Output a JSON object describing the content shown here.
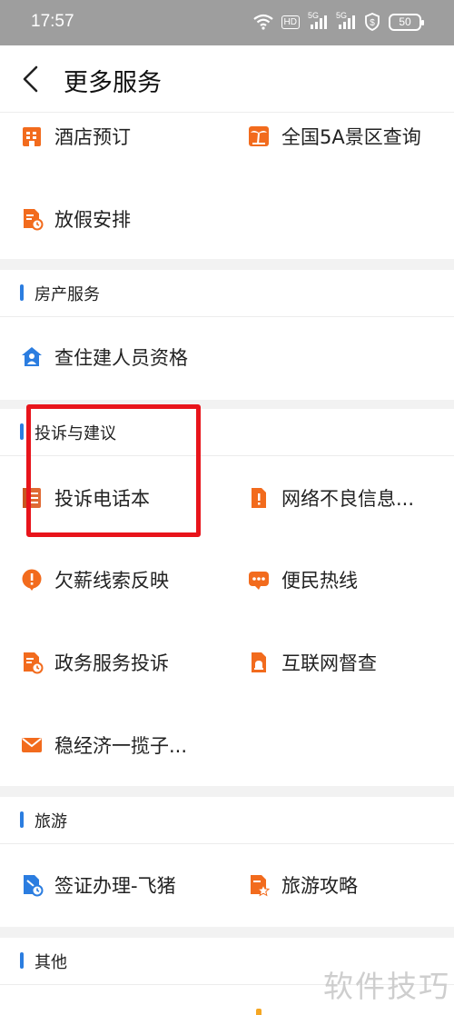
{
  "status": {
    "time": "17:57",
    "battery": "50",
    "hd": "HD",
    "signal1": "5G",
    "signal2": "5G"
  },
  "header": {
    "title": "更多服务"
  },
  "top_items": [
    {
      "label": "酒店预订",
      "icon": "hotel-icon"
    },
    {
      "label": "全国5A景区查询",
      "icon": "palm-tree-icon"
    },
    {
      "label": "放假安排",
      "icon": "document-clock-icon"
    }
  ],
  "sections": [
    {
      "title": "房产服务",
      "items": [
        {
          "label": "查住建人员资格",
          "icon": "house-person-icon"
        }
      ]
    },
    {
      "title": "投诉与建议",
      "items": [
        {
          "label": "投诉电话本",
          "icon": "phonebook-icon"
        },
        {
          "label": "网络不良信息...",
          "icon": "warning-doc-icon"
        },
        {
          "label": "欠薪线索反映",
          "icon": "exclamation-bubble-icon"
        },
        {
          "label": "便民热线",
          "icon": "chat-dots-icon"
        },
        {
          "label": "政务服务投诉",
          "icon": "document-clock-icon"
        },
        {
          "label": "互联网督查",
          "icon": "document-alarm-icon"
        },
        {
          "label": "稳经济一揽子...",
          "icon": "envelope-icon"
        }
      ]
    },
    {
      "title": "旅游",
      "items": [
        {
          "label": "签证办理-飞猪",
          "icon": "visa-doc-icon"
        },
        {
          "label": "旅游攻略",
          "icon": "guide-star-icon"
        }
      ]
    },
    {
      "title": "其他",
      "items": []
    }
  ],
  "watermark": "软件技巧",
  "colors": {
    "accent_blue": "#2b7de0",
    "icon_orange": "#f26b1d",
    "highlight_red": "#e8141b",
    "status_bar": "#9e9e9e"
  }
}
